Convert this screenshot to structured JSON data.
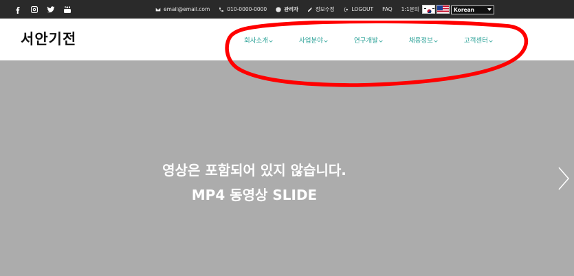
{
  "topbar": {
    "social_icons": [
      "facebook-icon",
      "instagram-icon",
      "twitter-icon",
      "youtube-icon"
    ],
    "email": "email@email.com",
    "phone": "010-0000-0000",
    "admin": "관리자",
    "edit_profile": "정보수정",
    "logout": "LOGOUT",
    "faq": "FAQ",
    "inquiry": "1:1문의",
    "language": "Korean"
  },
  "header": {
    "logo": "서안기전",
    "nav": [
      "회사소개",
      "사업분야",
      "연구개발",
      "채용정보",
      "고객센터"
    ]
  },
  "hero": {
    "line1": "영상은 포함되어 있지 않습니다.",
    "line2": "MP4 동영상 SLIDE"
  },
  "colors": {
    "topbar_bg": "#2a2a2a",
    "nav_text": "#2aa197",
    "hero_bg": "#acacac",
    "highlight": "#ff0000"
  }
}
